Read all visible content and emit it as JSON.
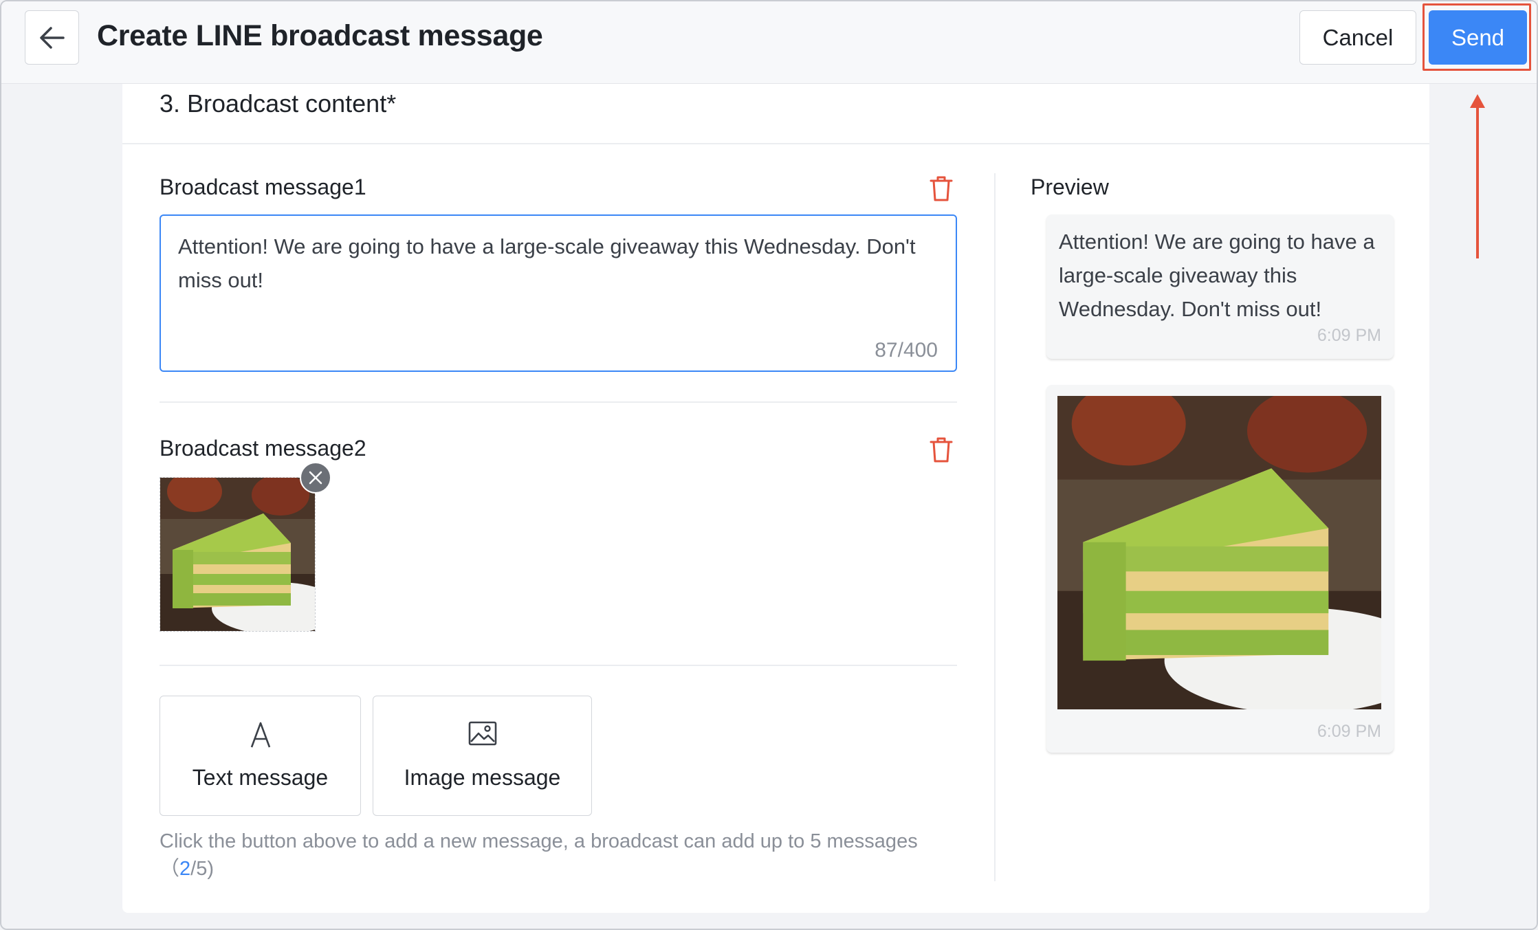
{
  "header": {
    "title": "Create LINE broadcast message",
    "cancel_label": "Cancel",
    "send_label": "Send"
  },
  "section": {
    "title": "3. Broadcast content*"
  },
  "messages": [
    {
      "label": "Broadcast message1",
      "text": "Attention! We are going to have a large-scale giveaway this Wednesday. Don't miss out!",
      "counter": "87/400"
    },
    {
      "label": "Broadcast message2",
      "type": "image"
    }
  ],
  "add_buttons": {
    "text_label": "Text message",
    "image_label": "Image message"
  },
  "hint": {
    "text": "Click the button above to add a new message, a broadcast can add up to 5 messages",
    "open": "（",
    "current": "2",
    "sep_max": "/5)"
  },
  "preview": {
    "label": "Preview",
    "text_bubble": "Attention! We are going to have a large-scale giveaway this Wednesday. Don't miss out!",
    "time1": "6:09 PM",
    "time2": "6:09 PM"
  },
  "colors": {
    "accent": "#3b87f6",
    "highlight": "#e5533c",
    "danger": "#e5533c"
  }
}
